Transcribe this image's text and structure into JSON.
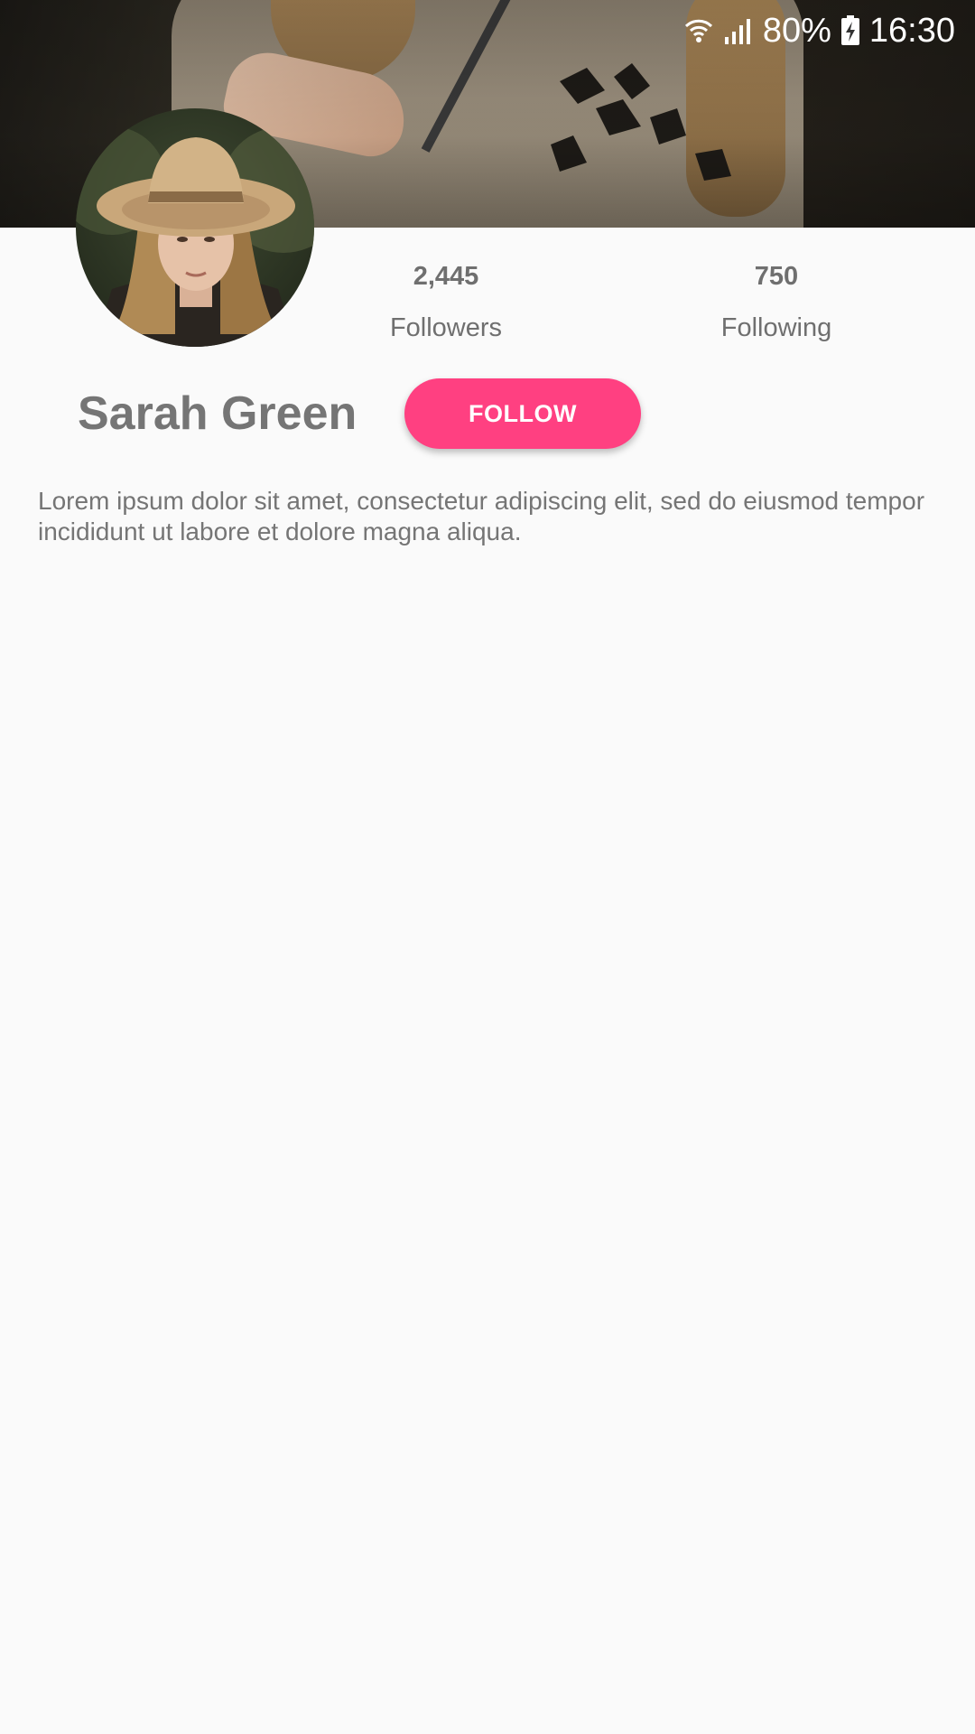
{
  "status_bar": {
    "battery": "80%",
    "time": "16:30",
    "icons": [
      "wifi-icon",
      "signal-icon",
      "battery-charging-icon"
    ]
  },
  "cover": {
    "image": "cover-photo"
  },
  "profile": {
    "avatar": "avatar-photo",
    "name": "Sarah Green",
    "bio": "Lorem ipsum dolor sit amet, consectetur adipiscing elit, sed do eiusmod tempor incididunt ut labore et dolore magna aliqua."
  },
  "stats": {
    "followers": {
      "value": "2,445",
      "label": "Followers"
    },
    "following": {
      "value": "750",
      "label": "Following"
    }
  },
  "actions": {
    "follow_label": "FOLLOW"
  },
  "colors": {
    "accent": "#ff4081",
    "text": "#757575",
    "background": "#fafafa"
  }
}
